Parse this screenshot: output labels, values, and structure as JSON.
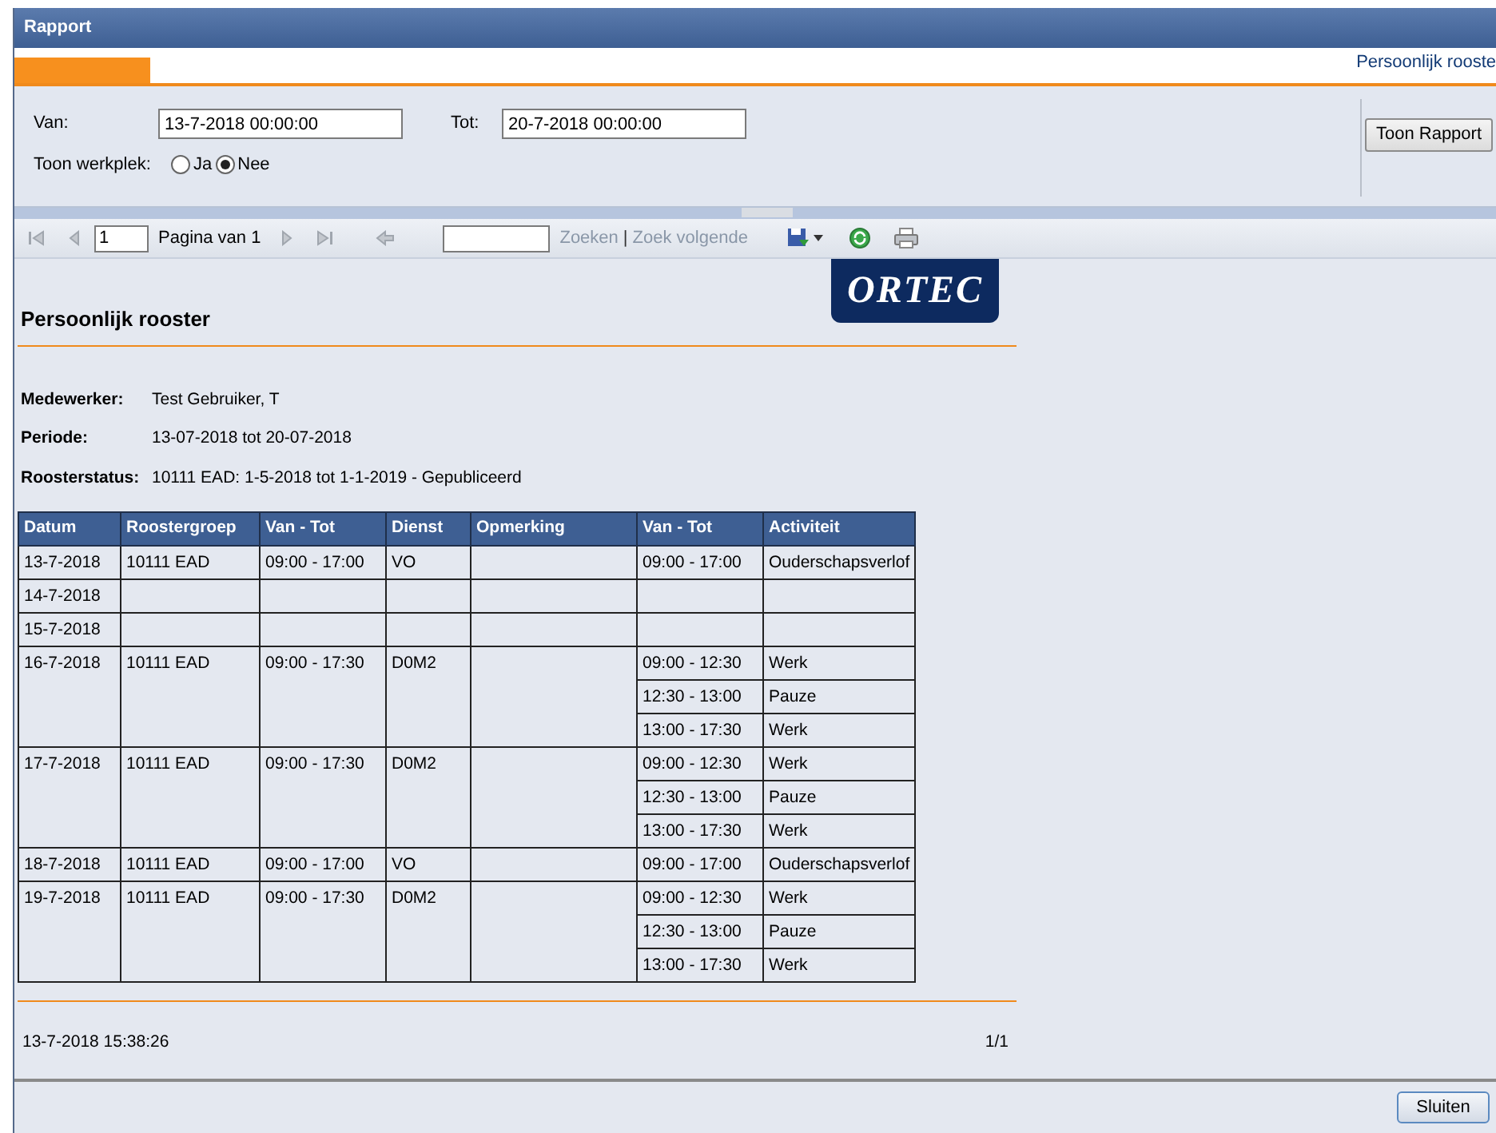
{
  "window": {
    "title": "Rapport"
  },
  "tabs": [
    {
      "label": "Persoonlijk rooste",
      "selected": true
    }
  ],
  "params": {
    "van_label": "Van:",
    "van_value": "13-7-2018 00:00:00",
    "tot_label": "Tot:",
    "tot_value": "20-7-2018 00:00:00",
    "werkplek_label": "Toon werkplek:",
    "options": [
      {
        "label": "Ja",
        "selected": false
      },
      {
        "label": "Nee",
        "selected": true
      }
    ],
    "button": "Toon Rapport"
  },
  "toolbar": {
    "page": "1",
    "page_label": "Pagina van 1",
    "search_link": "Zoeken",
    "separator": "|",
    "next_link": "Zoek volgende"
  },
  "report": {
    "logo": "ORTEC",
    "title": "Persoonlijk rooster",
    "info": [
      {
        "label": "Medewerker:",
        "value": "Test Gebruiker, T"
      },
      {
        "label": "Periode:",
        "value": "13-07-2018 tot 20-07-2018"
      },
      {
        "label": "Roosterstatus:",
        "value": "10111 EAD: 1-5-2018 tot 1-1-2019 - Gepubliceerd"
      }
    ],
    "columns": [
      "Datum",
      "Roostergroep",
      "Van - Tot",
      "Dienst",
      "Opmerking",
      "Van - Tot",
      "Activiteit"
    ],
    "rows": [
      {
        "datum": "13-7-2018",
        "groep": "10111 EAD",
        "tijd": "09:00 - 17:00",
        "dienst": "VO",
        "activities": [
          {
            "tijd": "09:00 - 17:00",
            "naam": "Ouderschapsverlof"
          }
        ]
      },
      {
        "datum": "14-7-2018",
        "activities": []
      },
      {
        "datum": "15-7-2018",
        "activities": []
      },
      {
        "datum": "16-7-2018",
        "groep": "10111 EAD",
        "tijd": "09:00 - 17:30",
        "dienst": "D0M2",
        "activities": [
          {
            "tijd": "09:00 - 12:30",
            "naam": "Werk"
          },
          {
            "tijd": "12:30 - 13:00",
            "naam": "Pauze"
          },
          {
            "tijd": "13:00 - 17:30",
            "naam": "Werk"
          }
        ]
      },
      {
        "datum": "17-7-2018",
        "groep": "10111 EAD",
        "tijd": "09:00 - 17:30",
        "dienst": "D0M2",
        "activities": [
          {
            "tijd": "09:00 - 12:30",
            "naam": "Werk"
          },
          {
            "tijd": "12:30 - 13:00",
            "naam": "Pauze"
          },
          {
            "tijd": "13:00 - 17:30",
            "naam": "Werk"
          }
        ]
      },
      {
        "datum": "18-7-2018",
        "groep": "10111 EAD",
        "tijd": "09:00 - 17:00",
        "dienst": "VO",
        "activities": [
          {
            "tijd": "09:00 - 17:00",
            "naam": "Ouderschapsverlof"
          }
        ]
      },
      {
        "datum": "19-7-2018",
        "groep": "10111 EAD",
        "tijd": "09:00 - 17:30",
        "dienst": "D0M2",
        "activities": [
          {
            "tijd": "09:00 - 12:30",
            "naam": "Werk"
          },
          {
            "tijd": "12:30 - 13:00",
            "naam": "Pauze"
          },
          {
            "tijd": "13:00 - 17:30",
            "naam": "Werk"
          }
        ]
      }
    ],
    "timestamp": "13-7-2018 15:38:26",
    "pages": "1/1"
  },
  "footer": {
    "button": "Sluiten"
  }
}
